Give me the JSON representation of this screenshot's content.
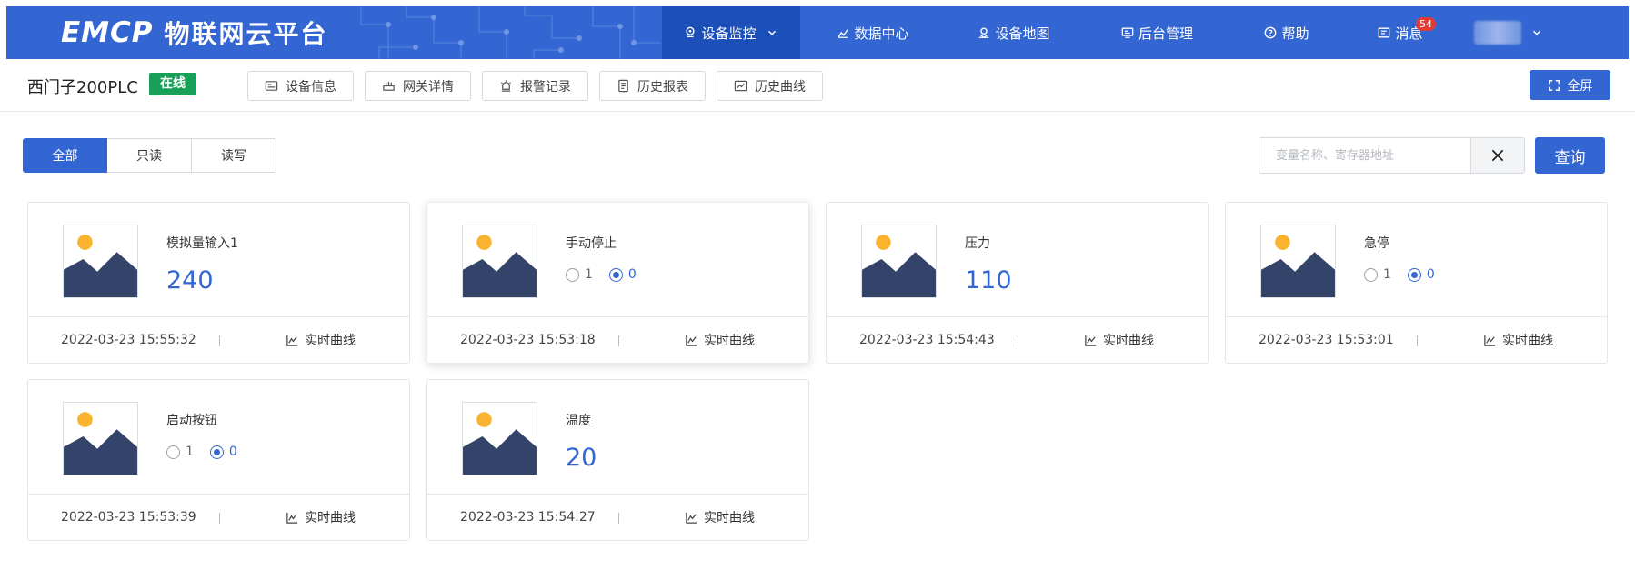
{
  "app": {
    "logo_mark": "EMCP",
    "logo_text": "物联网云平台"
  },
  "nav": {
    "items": [
      {
        "label": "设备监控",
        "icon": "location-pin-icon",
        "active": true,
        "dropdown": true
      },
      {
        "label": "数据中心",
        "icon": "bar-chart-icon"
      },
      {
        "label": "设备地图",
        "icon": "map-pin-icon"
      },
      {
        "label": "后台管理",
        "icon": "admin-panel-icon"
      },
      {
        "label": "帮助",
        "icon": "question-circle-icon"
      },
      {
        "label": "消息",
        "icon": "message-icon"
      }
    ],
    "message_badge": "54"
  },
  "device": {
    "name": "西门子200PLC",
    "status": "在线",
    "status_color": "#18a058"
  },
  "subtabs": [
    {
      "label": "设备信息",
      "icon": "info-card-icon"
    },
    {
      "label": "网关详情",
      "icon": "gateway-icon"
    },
    {
      "label": "报警记录",
      "icon": "alarm-icon"
    },
    {
      "label": "历史报表",
      "icon": "report-icon"
    },
    {
      "label": "历史曲线",
      "icon": "curve-chart-icon"
    }
  ],
  "fullscreen_label": "全屏",
  "filters": {
    "options": [
      "全部",
      "只读",
      "读写"
    ],
    "selected": "全部"
  },
  "search": {
    "placeholder": "变量名称、寄存器地址",
    "value": "",
    "query_label": "查询"
  },
  "accent_color": "#3366d2",
  "cards": [
    {
      "name": "模拟量输入1",
      "type": "value",
      "value": "240",
      "time": "2022-03-23 15:55:32",
      "curve_label": "实时曲线"
    },
    {
      "name": "手动停止",
      "type": "radio",
      "options": [
        "1",
        "0"
      ],
      "selected": "0",
      "time": "2022-03-23 15:53:18",
      "curve_label": "实时曲线"
    },
    {
      "name": "压力",
      "type": "value",
      "value": "110",
      "time": "2022-03-23 15:54:43",
      "curve_label": "实时曲线"
    },
    {
      "name": "急停",
      "type": "radio",
      "options": [
        "1",
        "0"
      ],
      "selected": "0",
      "time": "2022-03-23 15:53:01",
      "curve_label": "实时曲线"
    },
    {
      "name": "启动按钮",
      "type": "radio",
      "options": [
        "1",
        "0"
      ],
      "selected": "0",
      "time": "2022-03-23 15:53:39",
      "curve_label": "实时曲线"
    },
    {
      "name": "温度",
      "type": "value",
      "value": "20",
      "time": "2022-03-23 15:54:27",
      "curve_label": "实时曲线"
    }
  ]
}
